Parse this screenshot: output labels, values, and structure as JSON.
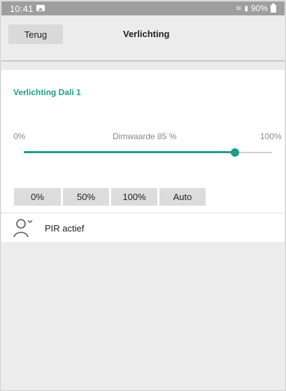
{
  "status_bar": {
    "time": "10:41",
    "battery": "90%",
    "icons": [
      "image-icon",
      "wifi-icon",
      "signal-icon",
      "battery-icon"
    ]
  },
  "header": {
    "back_label": "Terug",
    "title": "Verlichting"
  },
  "section": {
    "title": "Verlichting Dali 1"
  },
  "dimmer": {
    "min_label": "0%",
    "value_label": "Dimwaarde 85 %",
    "max_label": "100%",
    "value_percent": 85
  },
  "presets": [
    "0%",
    "50%",
    "100%",
    "Auto"
  ],
  "pir": {
    "label": "PIR actief",
    "icon": "person-icon"
  },
  "colors": {
    "accent": "#1f9d8a",
    "status_bar": "#9e9e9e",
    "background": "#ececec"
  }
}
